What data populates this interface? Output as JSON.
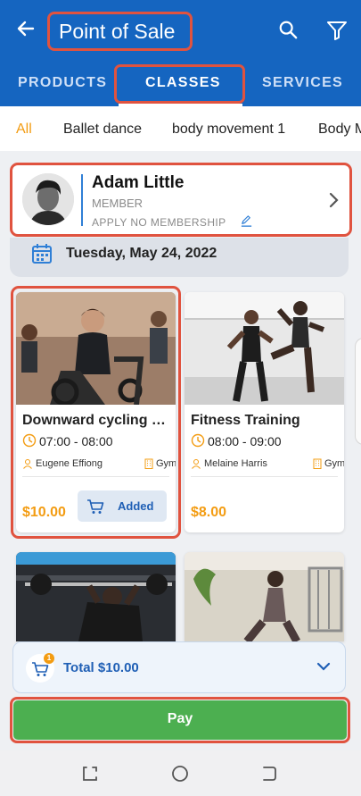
{
  "header": {
    "title": "Point of Sale",
    "back_icon": "arrow-left-icon",
    "search_icon": "search-icon",
    "filter_icon": "filter-icon"
  },
  "tabs": [
    {
      "label": "PRODUCTS",
      "active": false
    },
    {
      "label": "CLASSES",
      "active": true
    },
    {
      "label": "SERVICES",
      "active": false
    }
  ],
  "filters": [
    "All",
    "Ballet dance",
    "body movement 1",
    "Body M"
  ],
  "member": {
    "name": "Adam Little",
    "role": "MEMBER",
    "plan": "APPLY NO MEMBERSHIP"
  },
  "date": "Tuesday, May 24, 2022",
  "classes": [
    {
      "name": "Downward cycling cl...",
      "time": "07:00 - 08:00",
      "trainer": "Eugene Effiong",
      "room": "Gym",
      "price": "$10.00",
      "button": "Added"
    },
    {
      "name": "Fitness Training",
      "time": "08:00 - 09:00",
      "trainer": "Melaine Harris",
      "room": "Gym",
      "price": "$8.00"
    }
  ],
  "cart": {
    "count": "1",
    "total": "Total $10.00"
  },
  "pay": {
    "label": "Pay"
  },
  "colors": {
    "primary": "#1565c0",
    "accent": "#f39c12",
    "pay": "#4caf50",
    "highlight": "#e0533f"
  }
}
